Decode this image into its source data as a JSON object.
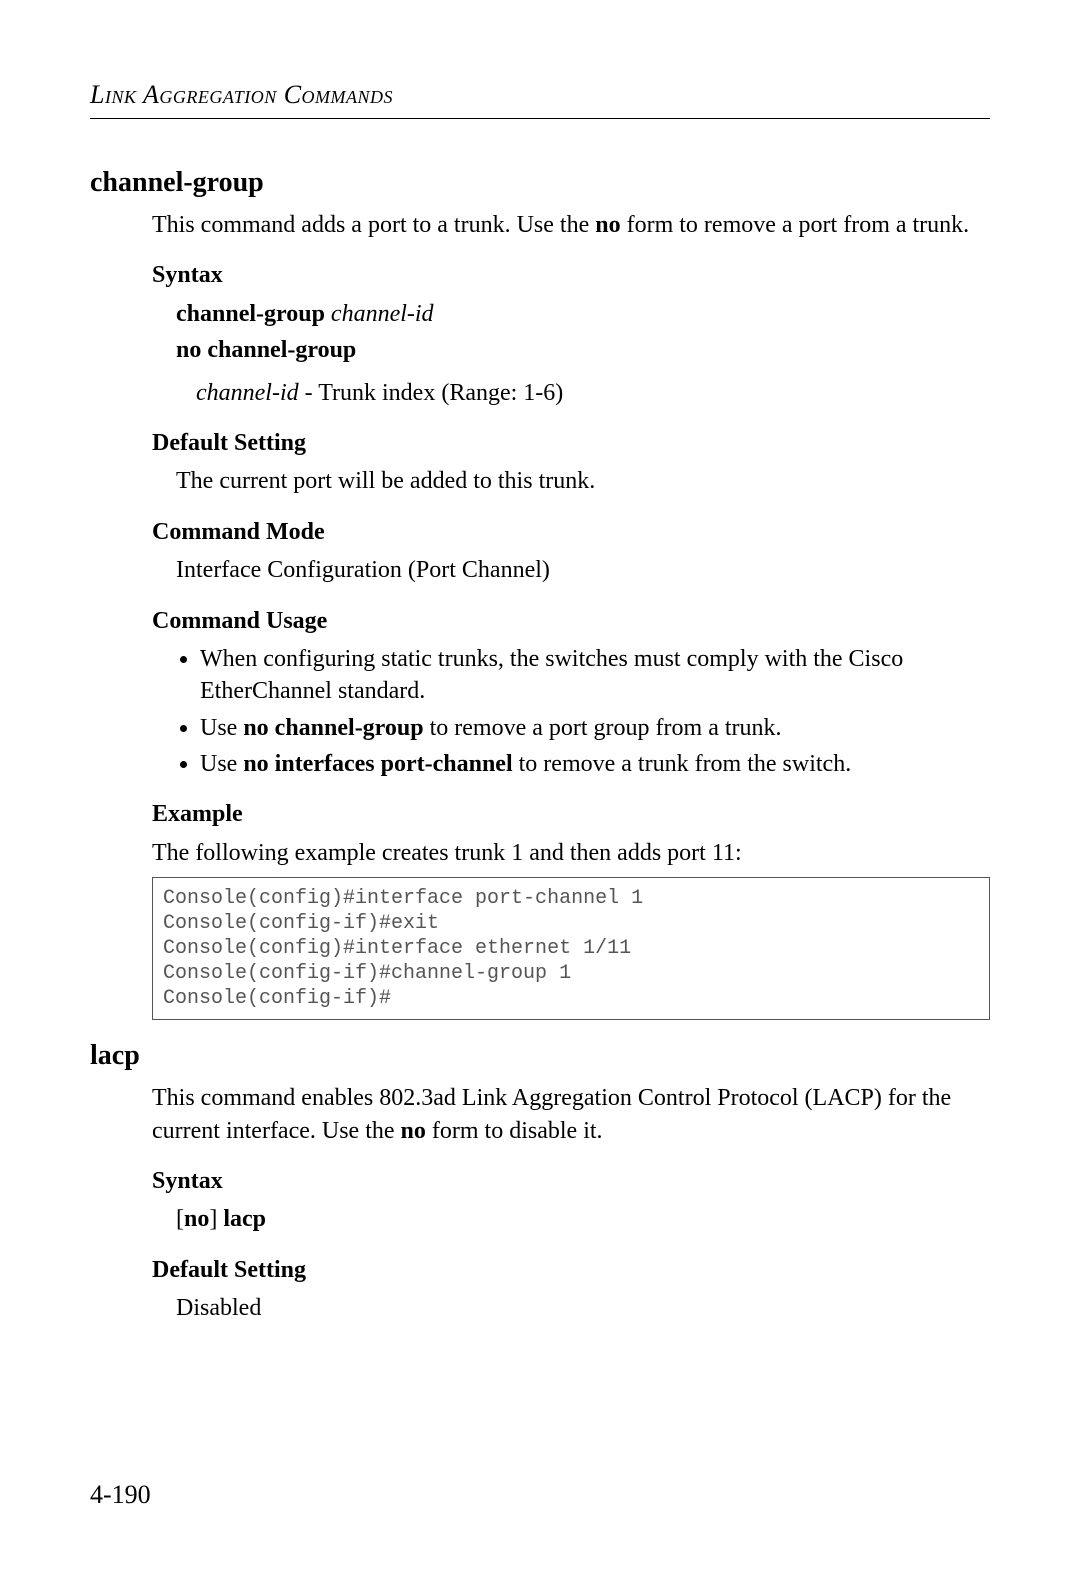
{
  "header": "Link Aggregation Commands",
  "page_number": "4-190",
  "sections": {
    "channel_group": {
      "title": "channel-group",
      "intro_pre": "This command adds a port to a trunk. Use the ",
      "intro_bold": "no",
      "intro_post": " form to remove a port from a trunk.",
      "syntax": {
        "heading": "Syntax",
        "line1_cmd": "channel-group",
        "line1_arg": "channel-id",
        "line2": "no channel-group",
        "arg_name": "channel-id",
        "arg_desc": " - Trunk index (Range: 1-6)"
      },
      "default": {
        "heading": "Default Setting",
        "text": "The current port will be added to this trunk."
      },
      "mode": {
        "heading": "Command Mode",
        "text": "Interface Configuration (Port Channel)"
      },
      "usage": {
        "heading": "Command Usage",
        "item1": "When configuring static trunks, the switches must comply with the Cisco EtherChannel standard.",
        "item2_pre": "Use ",
        "item2_bold": "no channel-group",
        "item2_post": " to remove a port group from a trunk.",
        "item3_pre": "Use ",
        "item3_bold": "no interfaces port-channel",
        "item3_post": " to remove a trunk from the switch."
      },
      "example": {
        "heading": "Example",
        "text": "The following example creates trunk 1 and then adds port 11:",
        "code": "Console(config)#interface port-channel 1\nConsole(config-if)#exit\nConsole(config)#interface ethernet 1/11\nConsole(config-if)#channel-group 1\nConsole(config-if)#"
      }
    },
    "lacp": {
      "title": "lacp",
      "intro_pre": "This command enables 802.3ad Link Aggregation Control Protocol (LACP) for the current interface. Use the ",
      "intro_bold": "no",
      "intro_post": " form to disable it.",
      "syntax": {
        "heading": "Syntax",
        "line_pre": "[",
        "line_bold1": "no",
        "line_mid": "] ",
        "line_bold2": "lacp"
      },
      "default": {
        "heading": "Default Setting",
        "text": "Disabled"
      }
    }
  }
}
